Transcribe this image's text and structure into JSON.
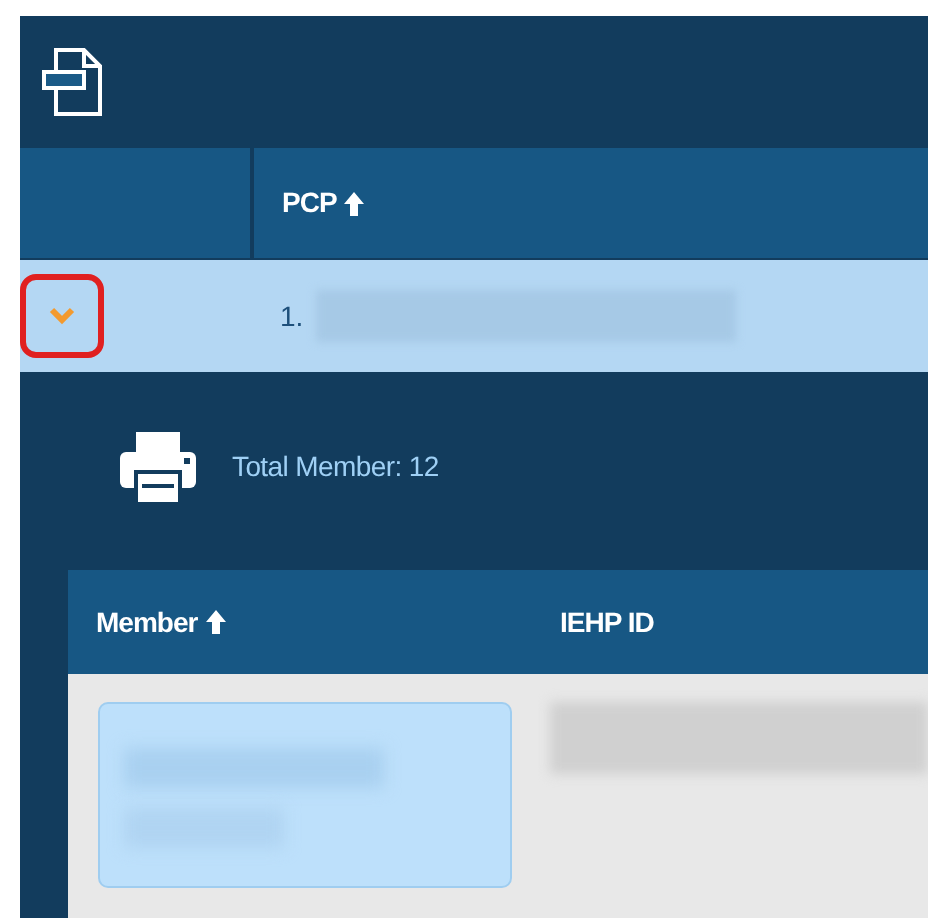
{
  "table": {
    "columns": [
      {
        "label": "PCP",
        "sorted": true
      }
    ],
    "rows": [
      {
        "index": "1.",
        "expanded": true,
        "highlighted": true,
        "detail": {
          "total": "Total Member: 12",
          "columns": [
            {
              "label": "Member",
              "sorted": true
            },
            {
              "label": "IEHP ID",
              "sorted": false
            }
          ]
        }
      }
    ]
  }
}
